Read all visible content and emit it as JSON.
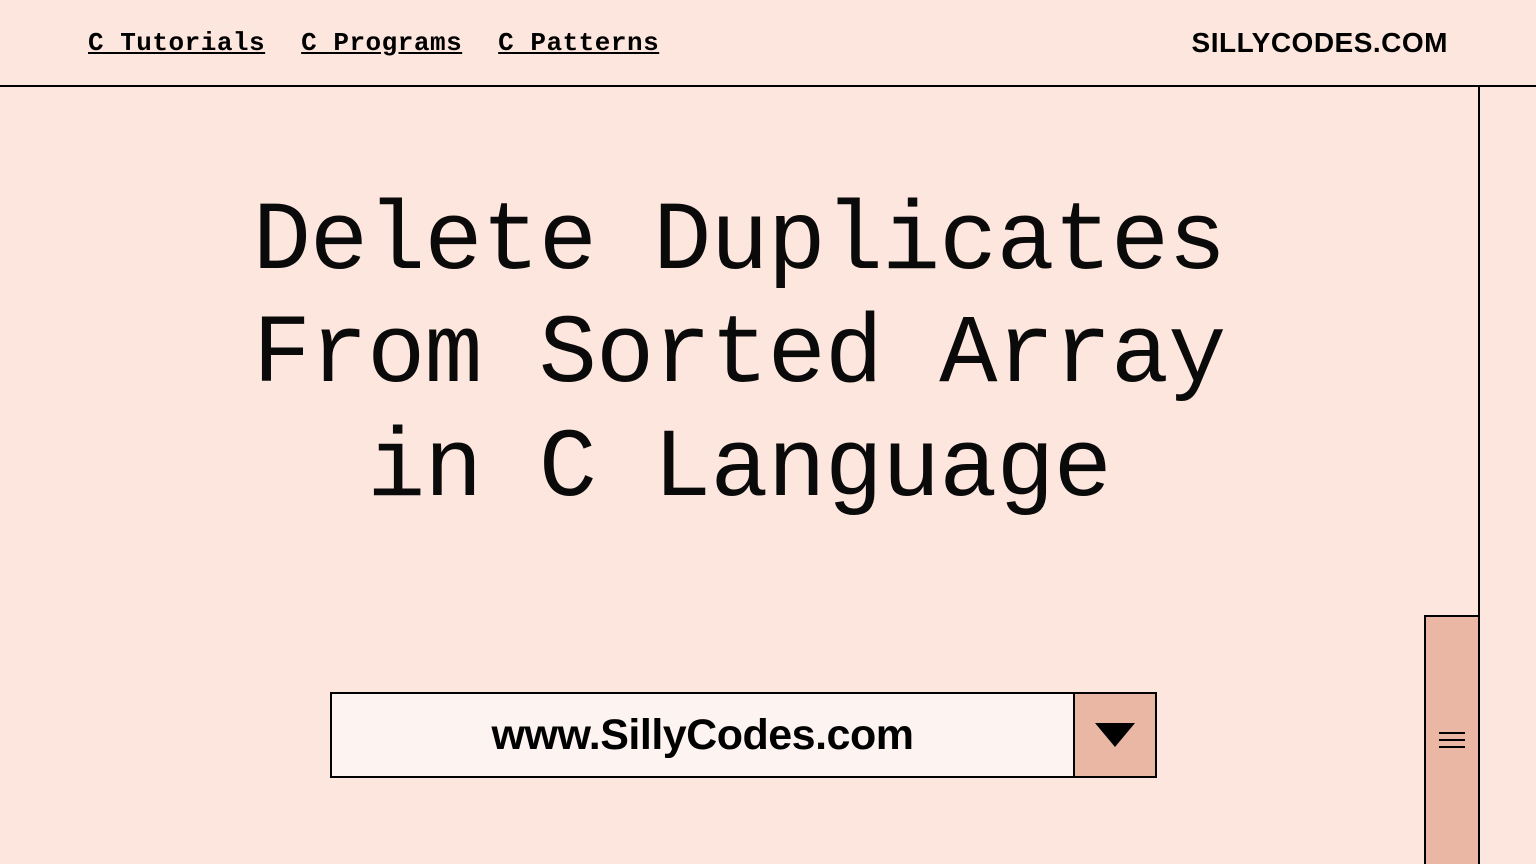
{
  "header": {
    "nav": [
      "C Tutorials",
      "C Programs",
      "C Patterns"
    ],
    "brand": "SILLYCODES.COM"
  },
  "main": {
    "title_line1": "Delete Duplicates",
    "title_line2": "From Sorted Array",
    "title_line3": "in C Language",
    "url": "www.SillyCodes.com"
  }
}
